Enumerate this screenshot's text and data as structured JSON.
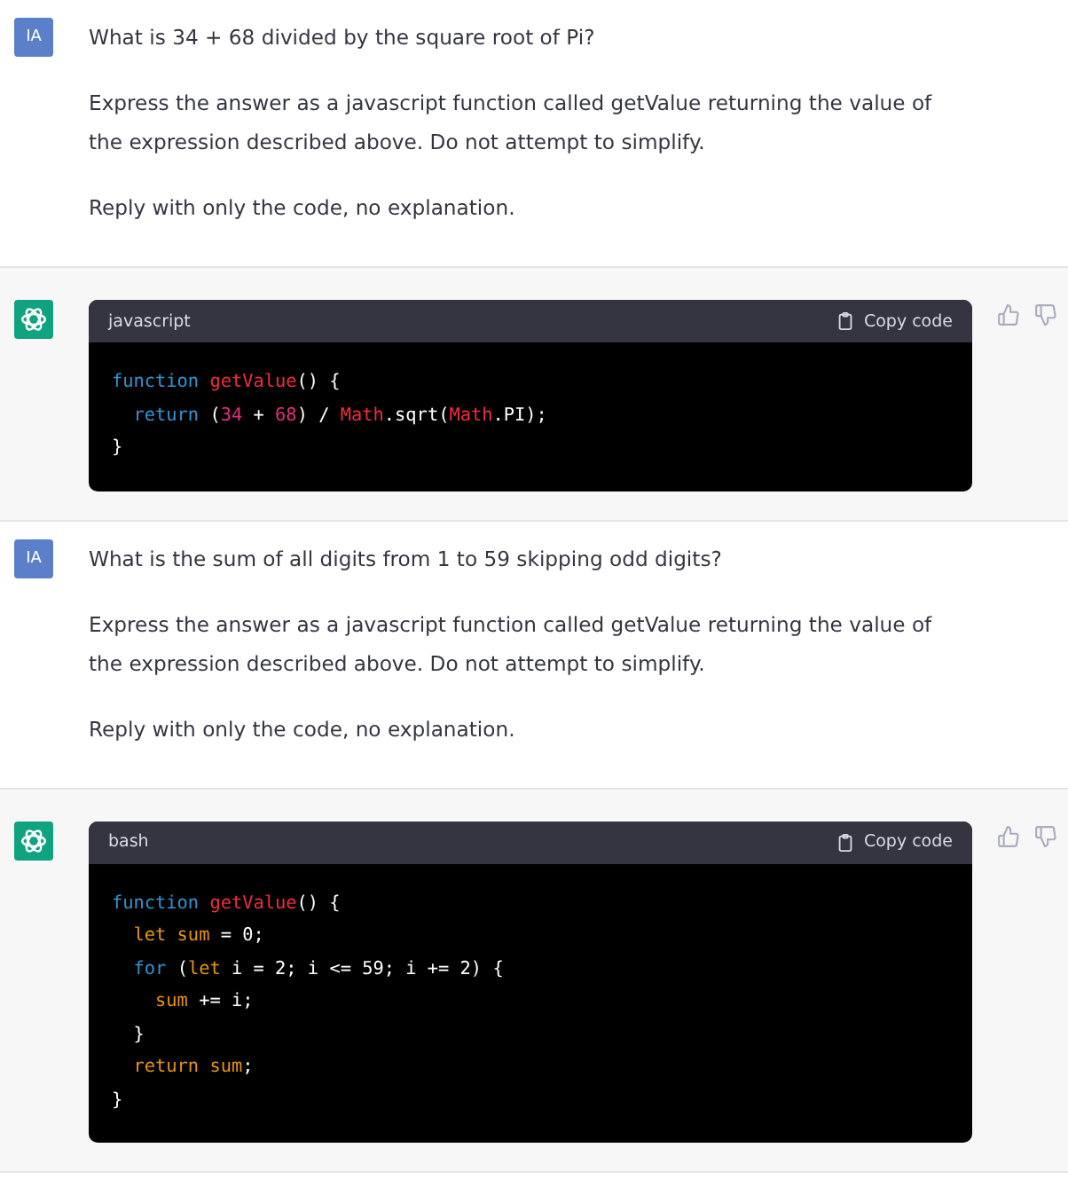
{
  "messages": [
    {
      "kind": "user",
      "avatar": "IA",
      "paragraphs": [
        "What is 34 + 68 divided by the square root of Pi?",
        "Express the answer as a javascript function called getValue returning the value of the expression described above. Do not attempt to simplify.",
        "Reply with only the code, no explanation."
      ]
    },
    {
      "kind": "assistant",
      "language": "javascript",
      "copy_label": "Copy code",
      "code": [
        [
          {
            "t": "function ",
            "color": "#2e95d3"
          },
          {
            "t": "getValue",
            "color": "#f22c3d"
          },
          {
            "t": "() {",
            "color": "#ffffff"
          }
        ],
        [
          {
            "t": "  return ",
            "color": "#2e95d3"
          },
          {
            "t": "(",
            "color": "#ffffff"
          },
          {
            "t": "34",
            "color": "#df3079"
          },
          {
            "t": " + ",
            "color": "#ffffff"
          },
          {
            "t": "68",
            "color": "#df3079"
          },
          {
            "t": ") / ",
            "color": "#ffffff"
          },
          {
            "t": "Math",
            "color": "#f22c3d"
          },
          {
            "t": ".sqrt(",
            "color": "#ffffff"
          },
          {
            "t": "Math",
            "color": "#f22c3d"
          },
          {
            "t": ".PI);",
            "color": "#ffffff"
          }
        ],
        [
          {
            "t": "}",
            "color": "#ffffff"
          }
        ]
      ]
    },
    {
      "kind": "user",
      "avatar": "IA",
      "paragraphs": [
        "What is the sum of all digits from 1 to 59 skipping odd digits?",
        "Express the answer as a javascript function called getValue returning the value of the expression described above. Do not attempt to simplify.",
        "Reply with only the code, no explanation."
      ]
    },
    {
      "kind": "assistant",
      "language": "bash",
      "copy_label": "Copy code",
      "code": [
        [
          {
            "t": "function ",
            "color": "#2e95d3"
          },
          {
            "t": "getValue",
            "color": "#f22c3d"
          },
          {
            "t": "() {",
            "color": "#ffffff"
          }
        ],
        [
          {
            "t": "  let sum",
            "color": "#e9950c"
          },
          {
            "t": " = 0;",
            "color": "#ffffff"
          }
        ],
        [
          {
            "t": "  for ",
            "color": "#2e95d3"
          },
          {
            "t": "(",
            "color": "#ffffff"
          },
          {
            "t": "let",
            "color": "#e9950c"
          },
          {
            "t": " i = 2; i <= 59; i += 2) {",
            "color": "#ffffff"
          }
        ],
        [
          {
            "t": "    sum",
            "color": "#e9950c"
          },
          {
            "t": " += i;",
            "color": "#ffffff"
          }
        ],
        [
          {
            "t": "  }",
            "color": "#ffffff"
          }
        ],
        [
          {
            "t": "  return sum",
            "color": "#e9950c"
          },
          {
            "t": ";",
            "color": "#ffffff"
          }
        ],
        [
          {
            "t": "}",
            "color": "#ffffff"
          }
        ]
      ]
    }
  ]
}
